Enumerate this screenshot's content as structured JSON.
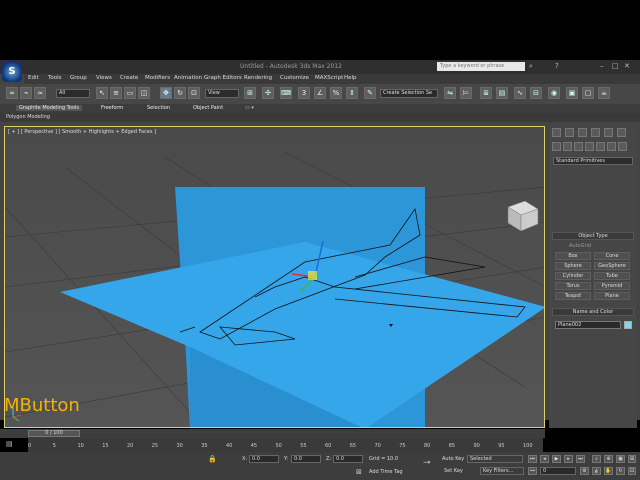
{
  "window": {
    "title": "Untitled - Autodesk 3ds Max 2012",
    "search_placeholder": "Type a keyword or phrase"
  },
  "menus": [
    "Edit",
    "Tools",
    "Group",
    "Views",
    "Create",
    "Modifiers",
    "Animation",
    "Graph Editors",
    "Rendering",
    "Customize",
    "MAXScript",
    "Help"
  ],
  "toolbar": {
    "selection_filter": "All",
    "reference_coord": "View",
    "named_selection": "Create Selection Se"
  },
  "ribbon": {
    "tabs": [
      "Graphite Modeling Tools",
      "Freeform",
      "Selection",
      "Object Paint"
    ],
    "sub_label": "Polygon Modeling"
  },
  "viewport": {
    "label": "[ + ] [ Perspective ] [ Smooth + Highlights + Edged Faces ]"
  },
  "command_panel": {
    "category": "Standard Primitives",
    "object_type_title": "Object Type",
    "autogrid": "AutoGrid",
    "buttons": [
      "Box",
      "Cone",
      "Sphere",
      "GeoSphere",
      "Cylinder",
      "Tube",
      "Torus",
      "Pyramid",
      "Teapot",
      "Plane"
    ],
    "name_color_title": "Name and Color",
    "object_name": "Plane002",
    "color": "#7fd8f0"
  },
  "timeline": {
    "slider": "0 / 100",
    "ticks": [
      "0",
      "5",
      "10",
      "15",
      "20",
      "25",
      "30",
      "35",
      "40",
      "45",
      "50",
      "55",
      "60",
      "65",
      "70",
      "75",
      "80",
      "85",
      "90",
      "95",
      "100"
    ]
  },
  "status": {
    "overlay_text": "MButton",
    "x_label": "X:",
    "x_value": "0.0",
    "y_label": "Y:",
    "y_value": "0.0",
    "z_label": "Z:",
    "z_value": "0.0",
    "grid": "Grid = 10.0",
    "add_time_tag": "Add Time Tag",
    "auto_key": "Auto Key",
    "auto_key_value": "Selected",
    "set_key": "Set Key",
    "key_filters": "Key Filters...",
    "frame": "0"
  },
  "colors": {
    "plane": "#2e9be0",
    "accent": "#f2b400",
    "viewport_border": "#ddd26a"
  }
}
